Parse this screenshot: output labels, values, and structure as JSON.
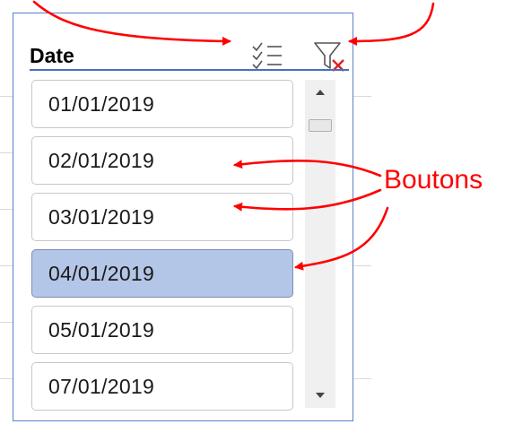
{
  "slicer": {
    "title": "Date",
    "items": [
      {
        "label": "01/01/2019",
        "selected": false
      },
      {
        "label": "02/01/2019",
        "selected": false
      },
      {
        "label": "03/01/2019",
        "selected": false
      },
      {
        "label": "04/01/2019",
        "selected": true
      },
      {
        "label": "05/01/2019",
        "selected": false
      },
      {
        "label": "07/01/2019",
        "selected": false
      }
    ],
    "icons": {
      "multi_select": "multi-select-icon",
      "clear_filter": "clear-filter-icon"
    }
  },
  "annotation": {
    "label": "Boutons",
    "color": "#ff0000"
  },
  "colors": {
    "panel_border": "#5b7fcf",
    "selected_fill": "#b4c6e7",
    "header_underline": "#4a6fc0"
  }
}
